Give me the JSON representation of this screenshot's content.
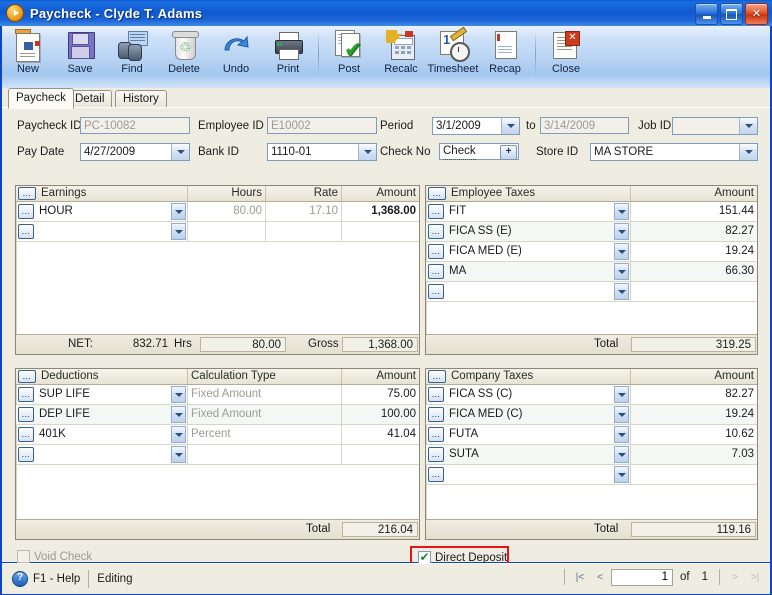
{
  "window": {
    "title": "Paycheck - Clyde T. Adams",
    "icon": "play-circle-icon",
    "buttons": {
      "minimize": "minimize-icon",
      "maximize": "maximize-icon",
      "close": "close-icon"
    }
  },
  "toolbar": {
    "items": [
      {
        "label": "New",
        "icon": "new-document-icon"
      },
      {
        "label": "Save",
        "icon": "floppy-disk-icon"
      },
      {
        "label": "Find",
        "icon": "binoculars-icon"
      },
      {
        "label": "Delete",
        "icon": "recycle-bin-icon"
      },
      {
        "label": "Undo",
        "icon": "undo-arrow-icon"
      },
      {
        "label": "Print",
        "icon": "printer-icon"
      },
      {
        "label": "Post",
        "icon": "post-checkmark-icon"
      },
      {
        "label": "Recalc",
        "icon": "calculator-icon"
      },
      {
        "label": "Timesheet",
        "icon": "timesheet-clock-icon"
      },
      {
        "label": "Recap",
        "icon": "recap-report-icon"
      },
      {
        "label": "Close",
        "icon": "close-document-icon"
      }
    ]
  },
  "tabs": [
    {
      "label": "Paycheck",
      "active": true
    },
    {
      "label": "Detail",
      "active": false
    },
    {
      "label": "History",
      "active": false
    }
  ],
  "form": {
    "paycheck_id": {
      "label": "Paycheck ID",
      "value": "PC-10082",
      "readonly": true
    },
    "employee_id": {
      "label": "Employee ID",
      "value": "E10002",
      "readonly": true
    },
    "period": {
      "label": "Period",
      "value": "3/1/2009"
    },
    "period_to_label": "to",
    "period_to": {
      "value": "3/14/2009",
      "readonly": true
    },
    "job_id": {
      "label": "Job ID",
      "value": ""
    },
    "pay_date": {
      "label": "Pay Date",
      "value": "4/27/2009"
    },
    "bank_id": {
      "label": "Bank ID",
      "value": "1110-01"
    },
    "check_no": {
      "label": "Check No",
      "value": "Check",
      "button": "+"
    },
    "store_id": {
      "label": "Store ID",
      "value": "MA STORE"
    }
  },
  "earnings": {
    "headers": [
      "Earnings",
      "Hours",
      "Rate",
      "Amount"
    ],
    "rows": [
      {
        "name": "HOUR",
        "hours": "80.00",
        "rate": "17.10",
        "amount": "1,368.00"
      },
      {
        "name": "",
        "hours": "",
        "rate": "",
        "amount": ""
      }
    ],
    "footer": {
      "net_label": "NET:",
      "net_value": "832.71",
      "hrs_label": "Hrs",
      "hrs_value": "80.00",
      "gross_label": "Gross",
      "gross_value": "1,368.00"
    }
  },
  "employee_taxes": {
    "headers": [
      "Employee Taxes",
      "Amount"
    ],
    "rows": [
      {
        "name": "FIT",
        "amount": "151.44"
      },
      {
        "name": "FICA SS (E)",
        "amount": "82.27"
      },
      {
        "name": "FICA MED (E)",
        "amount": "19.24"
      },
      {
        "name": "MA",
        "amount": "66.30"
      },
      {
        "name": "",
        "amount": ""
      }
    ],
    "footer": {
      "label": "Total",
      "value": "319.25"
    }
  },
  "deductions": {
    "headers": [
      "Deductions",
      "Calculation Type",
      "Amount"
    ],
    "rows": [
      {
        "name": "SUP LIFE",
        "calc": "Fixed Amount",
        "amount": "75.00"
      },
      {
        "name": "DEP LIFE",
        "calc": "Fixed Amount",
        "amount": "100.00"
      },
      {
        "name": "401K",
        "calc": "Percent",
        "amount": "41.04"
      },
      {
        "name": "",
        "calc": "",
        "amount": ""
      }
    ],
    "footer": {
      "label": "Total",
      "value": "216.04"
    }
  },
  "company_taxes": {
    "headers": [
      "Company Taxes",
      "Amount"
    ],
    "rows": [
      {
        "name": "FICA SS (C)",
        "amount": "82.27"
      },
      {
        "name": "FICA MED (C)",
        "amount": "19.24"
      },
      {
        "name": "FUTA",
        "amount": "10.62"
      },
      {
        "name": "SUTA",
        "amount": "7.03"
      },
      {
        "name": "",
        "amount": ""
      }
    ],
    "footer": {
      "label": "Total",
      "value": "119.16"
    }
  },
  "checkboxes": {
    "void_check": {
      "label": "Void Check",
      "checked": false,
      "disabled": true
    },
    "direct_deposit": {
      "label": "Direct Deposit",
      "checked": true,
      "highlighted": true,
      "highlight_color": "#e81313"
    }
  },
  "statusbar": {
    "help": "F1 - Help",
    "mode": "Editing",
    "nav": {
      "first": "|<",
      "prev": "<",
      "page": "1",
      "of": "of",
      "total": "1",
      "next": ">",
      "last": ">|"
    }
  },
  "row_dots_icon": "ellipsis-button-icon"
}
